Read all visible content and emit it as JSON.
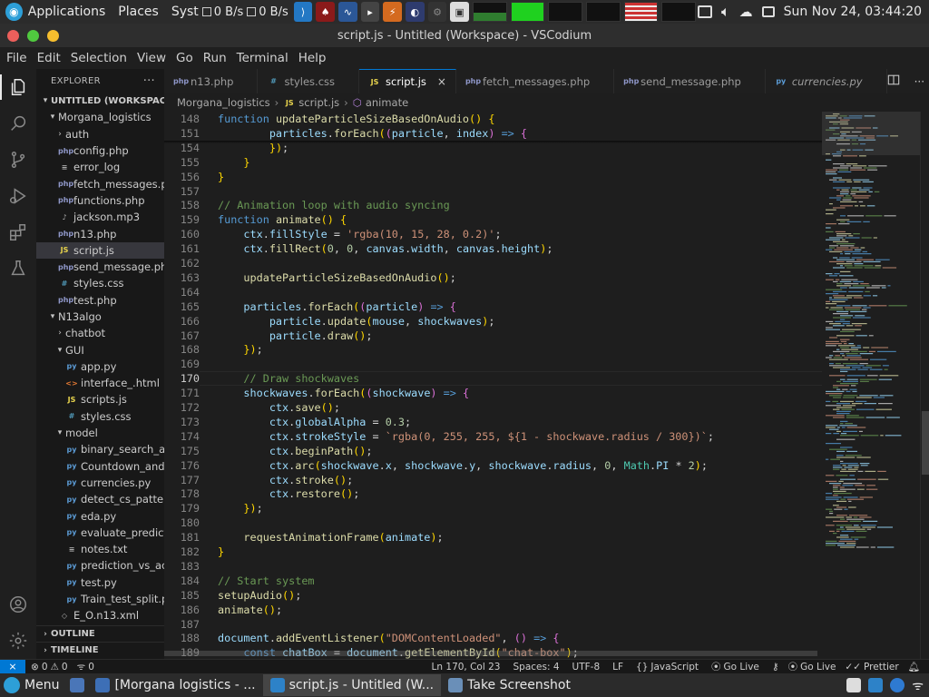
{
  "top_panel": {
    "applications": "Applications",
    "places": "Places",
    "system": "Syst",
    "net_down": "0 B/s",
    "net_up": "0 B/s",
    "clock": "Sun Nov 24, 03:44:20"
  },
  "window": {
    "title": "script.js - Untitled (Workspace) - VSCodium"
  },
  "menu": [
    "File",
    "Edit",
    "Selection",
    "View",
    "Go",
    "Run",
    "Terminal",
    "Help"
  ],
  "sidebar": {
    "title": "EXPLORER",
    "workspace": "UNTITLED (WORKSPACE)",
    "tree": [
      {
        "label": "Morgana_logistics",
        "depth": 1,
        "kind": "folder-open"
      },
      {
        "label": "auth",
        "depth": 2,
        "kind": "folder"
      },
      {
        "label": "config.php",
        "depth": 2,
        "kind": "php"
      },
      {
        "label": "error_log",
        "depth": 2,
        "kind": "log"
      },
      {
        "label": "fetch_messages.php",
        "depth": 2,
        "kind": "php"
      },
      {
        "label": "functions.php",
        "depth": 2,
        "kind": "php"
      },
      {
        "label": "jackson.mp3",
        "depth": 2,
        "kind": "mp3"
      },
      {
        "label": "n13.php",
        "depth": 2,
        "kind": "php"
      },
      {
        "label": "script.js",
        "depth": 2,
        "kind": "js",
        "selected": true
      },
      {
        "label": "send_message.php",
        "depth": 2,
        "kind": "php"
      },
      {
        "label": "styles.css",
        "depth": 2,
        "kind": "css"
      },
      {
        "label": "test.php",
        "depth": 2,
        "kind": "php"
      },
      {
        "label": "N13algo",
        "depth": 1,
        "kind": "folder-open"
      },
      {
        "label": "chatbot",
        "depth": 2,
        "kind": "folder"
      },
      {
        "label": "GUI",
        "depth": 2,
        "kind": "folder-open"
      },
      {
        "label": "app.py",
        "depth": 3,
        "kind": "py"
      },
      {
        "label": "interface_.html",
        "depth": 3,
        "kind": "html"
      },
      {
        "label": "scripts.js",
        "depth": 3,
        "kind": "js"
      },
      {
        "label": "styles.css",
        "depth": 3,
        "kind": "css"
      },
      {
        "label": "model",
        "depth": 2,
        "kind": "folder-open"
      },
      {
        "label": "binary_search_algo...",
        "depth": 3,
        "kind": "py"
      },
      {
        "label": "Countdown_and_ti...",
        "depth": 3,
        "kind": "py"
      },
      {
        "label": "currencies.py",
        "depth": 3,
        "kind": "py"
      },
      {
        "label": "detect_cs_patterns...",
        "depth": 3,
        "kind": "py"
      },
      {
        "label": "eda.py",
        "depth": 3,
        "kind": "py"
      },
      {
        "label": "evaluate_predict.py",
        "depth": 3,
        "kind": "py"
      },
      {
        "label": "notes.txt",
        "depth": 3,
        "kind": "txt"
      },
      {
        "label": "prediction_vs_actu...",
        "depth": 3,
        "kind": "py"
      },
      {
        "label": "test.py",
        "depth": 3,
        "kind": "py"
      },
      {
        "label": "Train_test_split.py",
        "depth": 3,
        "kind": "py"
      },
      {
        "label": "E_O.n13.xml",
        "depth": 2,
        "kind": "xml"
      }
    ],
    "outline": "OUTLINE",
    "timeline": "TIMELINE"
  },
  "tabs": [
    {
      "label": "n13.php",
      "kind": "php"
    },
    {
      "label": "styles.css",
      "kind": "css"
    },
    {
      "label": "script.js",
      "kind": "js",
      "active": true
    },
    {
      "label": "fetch_messages.php",
      "kind": "php"
    },
    {
      "label": "send_message.php",
      "kind": "php"
    },
    {
      "label": "currencies.py",
      "kind": "py",
      "italic": true
    }
  ],
  "breadcrumb": {
    "folder": "Morgana_logistics",
    "file": "script.js",
    "symbol": "animate"
  },
  "editor": {
    "current_line": "170",
    "lines": [
      {
        "n": "148",
        "t": "function updateParticleSizeBasedOnAudio() {"
      },
      {
        "n": "151",
        "t": "        particles.forEach((particle, index) => {"
      },
      {
        "n": "154",
        "t": "        });"
      },
      {
        "n": "155",
        "t": "    }"
      },
      {
        "n": "156",
        "t": "}"
      },
      {
        "n": "157",
        "t": ""
      },
      {
        "n": "158",
        "t": "// Animation loop with audio syncing"
      },
      {
        "n": "159",
        "t": "function animate() {"
      },
      {
        "n": "160",
        "t": "    ctx.fillStyle = 'rgba(10, 15, 28, 0.2)';"
      },
      {
        "n": "161",
        "t": "    ctx.fillRect(0, 0, canvas.width, canvas.height);"
      },
      {
        "n": "162",
        "t": ""
      },
      {
        "n": "163",
        "t": "    updateParticleSizeBasedOnAudio();"
      },
      {
        "n": "164",
        "t": ""
      },
      {
        "n": "165",
        "t": "    particles.forEach((particle) => {"
      },
      {
        "n": "166",
        "t": "        particle.update(mouse, shockwaves);"
      },
      {
        "n": "167",
        "t": "        particle.draw();"
      },
      {
        "n": "168",
        "t": "    });"
      },
      {
        "n": "169",
        "t": ""
      },
      {
        "n": "170",
        "t": "    // Draw shockwaves"
      },
      {
        "n": "171",
        "t": "    shockwaves.forEach((shockwave) => {"
      },
      {
        "n": "172",
        "t": "        ctx.save();"
      },
      {
        "n": "173",
        "t": "        ctx.globalAlpha = 0.3;"
      },
      {
        "n": "174",
        "t": "        ctx.strokeStyle = `rgba(0, 255, 255, ${1 - shockwave.radius / 300})`;"
      },
      {
        "n": "175",
        "t": "        ctx.beginPath();"
      },
      {
        "n": "176",
        "t": "        ctx.arc(shockwave.x, shockwave.y, shockwave.radius, 0, Math.PI * 2);"
      },
      {
        "n": "177",
        "t": "        ctx.stroke();"
      },
      {
        "n": "178",
        "t": "        ctx.restore();"
      },
      {
        "n": "179",
        "t": "    });"
      },
      {
        "n": "180",
        "t": ""
      },
      {
        "n": "181",
        "t": "    requestAnimationFrame(animate);"
      },
      {
        "n": "182",
        "t": "}"
      },
      {
        "n": "183",
        "t": ""
      },
      {
        "n": "184",
        "t": "// Start system"
      },
      {
        "n": "185",
        "t": "setupAudio();"
      },
      {
        "n": "186",
        "t": "animate();"
      },
      {
        "n": "187",
        "t": ""
      },
      {
        "n": "188",
        "t": "document.addEventListener(\"DOMContentLoaded\", () => {"
      },
      {
        "n": "189",
        "t": "    const chatBox = document.getElementById(\"chat-box\");"
      }
    ]
  },
  "status": {
    "errors": "0",
    "warnings": "0",
    "ports": "0",
    "position": "Ln 170, Col 23",
    "spaces": "Spaces: 4",
    "encoding": "UTF-8",
    "eol": "LF",
    "language": "JavaScript",
    "go_live_1": "Go Live",
    "go_live_2": "Go Live",
    "prettier": "Prettier"
  },
  "taskbar": {
    "menu": "Menu",
    "tasks": [
      {
        "label": "[Morgana logistics - ...",
        "color": "#3d6fb6"
      },
      {
        "label": "script.js - Untitled (W...",
        "color": "#2d82c8",
        "active": true
      },
      {
        "label": "Take Screenshot",
        "color": "#6a8fb8"
      }
    ]
  },
  "colors": {
    "accent": "#0078d4",
    "keyword": "#569cd6",
    "function": "#dcdcaa",
    "variable": "#9cdcfe",
    "string": "#ce9178",
    "comment": "#6a9955"
  }
}
